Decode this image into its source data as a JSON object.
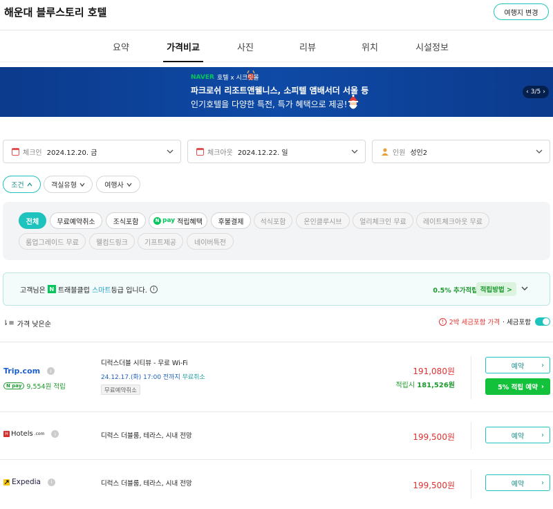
{
  "header": {
    "hotel_name": "해운대 블루스토리 호텔",
    "change_trip_label": "여행지 변경"
  },
  "tabs": [
    {
      "label": "요약",
      "active": false
    },
    {
      "label": "가격비교",
      "active": true
    },
    {
      "label": "사진",
      "active": false
    },
    {
      "label": "리뷰",
      "active": false
    },
    {
      "label": "위치",
      "active": false
    },
    {
      "label": "시설정보",
      "active": false
    }
  ],
  "banner": {
    "brand_naver": "NAVER",
    "brand_rest": "호텔 x 시크릿몰",
    "line1": "파크로쉬 리조트앤웰니스, 소피텔 앰배서더 서울 등",
    "line2": "인기호텔을 다양한 특전, 특가 혜택으로 제공!",
    "page_indicator": "3/5"
  },
  "search": {
    "checkin_label": "체크인",
    "checkin_value": "2024.12.20. 금",
    "checkout_label": "체크아웃",
    "checkout_value": "2024.12.22. 일",
    "guests_label": "인원",
    "guests_value": "성인2"
  },
  "filters": {
    "conditions_label": "조건",
    "room_type_label": "객실유형",
    "agency_label": "여행사"
  },
  "panel_pills": [
    {
      "label": "전체",
      "state": "selected"
    },
    {
      "label": "무료예약취소",
      "state": "normal"
    },
    {
      "label": "조식포함",
      "state": "normal"
    },
    {
      "label": "적립혜택",
      "state": "normal",
      "npay": true
    },
    {
      "label": "후불결제",
      "state": "normal"
    },
    {
      "label": "석식포함",
      "state": "dim"
    },
    {
      "label": "온인클루시브",
      "state": "dim"
    },
    {
      "label": "얼리체크인 무료",
      "state": "dim"
    },
    {
      "label": "레이트체크아웃 무료",
      "state": "dim"
    },
    {
      "label": "룸업그레이드 무료",
      "state": "dim"
    },
    {
      "label": "웰컴드링크",
      "state": "dim"
    },
    {
      "label": "기프트제공",
      "state": "dim"
    },
    {
      "label": "네이버특전",
      "state": "dim"
    }
  ],
  "npay_text": "pay",
  "member": {
    "prefix": "고객님은",
    "club": "트래블클럽",
    "grade": "스마트",
    "suffix": "등급 입니다.",
    "reward_rate": "0.5% 추가적립",
    "reward_method": "적립방법 >"
  },
  "sort": {
    "label": "가격 낮은순",
    "tax_note": "2박 세금포함 가격",
    "tax_toggle_label": "· 세금포함"
  },
  "offers": [
    {
      "vendor": "Trip.com",
      "npay_reward": "9,554원 적립",
      "room": "디럭스더블 시티뷰 - 무료 Wi-Fi",
      "cancel_date": "24.12.17.(화) 17:00 전까지",
      "cancel_text": "무료취소",
      "tag": "무료예약취소",
      "price": "191,080원",
      "reward_price_label": "적립시",
      "reward_price": "181,526원",
      "book_label": "예약",
      "book2_label": "5% 적립 예약"
    },
    {
      "vendor": "Hotels",
      "vendor_suffix": ".com",
      "room": "디럭스 더블룸, 테라스, 시내 전망",
      "price": "199,500원",
      "book_label": "예약"
    },
    {
      "vendor": "Expedia",
      "room": "디럭스 더블룸, 테라스, 시내 전망",
      "price": "199,500원",
      "book_label": "예약"
    }
  ],
  "colors": {
    "accent": "#1fc3bd",
    "price_red": "#e03030",
    "reward_green": "#13c13a",
    "banner_blue": "#0e4aa6"
  }
}
